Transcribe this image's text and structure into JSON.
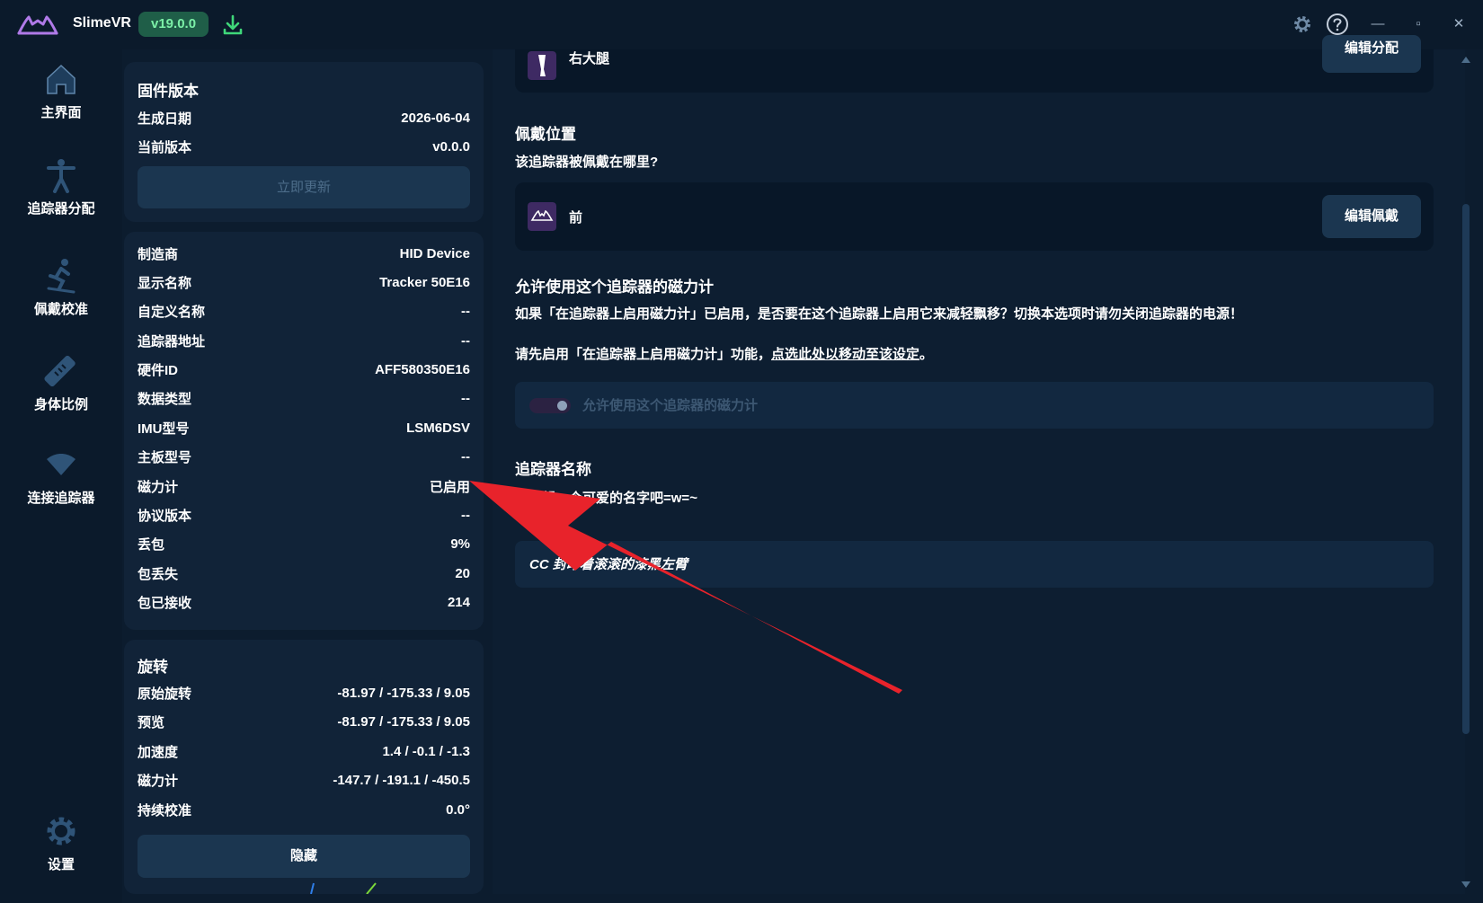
{
  "app": {
    "name": "SlimeVR",
    "version": "v19.0.0"
  },
  "sidebar": {
    "items": [
      {
        "label": "主界面",
        "icon": "home-icon"
      },
      {
        "label": "追踪器分配",
        "icon": "person-icon"
      },
      {
        "label": "佩戴校准",
        "icon": "skier-icon"
      },
      {
        "label": "身体比例",
        "icon": "ruler-icon"
      },
      {
        "label": "连接追踪器",
        "icon": "wifi-icon"
      },
      {
        "label": "设置",
        "icon": "gear-icon"
      }
    ]
  },
  "firmware": {
    "title": "固件版本",
    "rows": [
      {
        "k": "生成日期",
        "v": "2026-06-04"
      },
      {
        "k": "当前版本",
        "v": "v0.0.0"
      }
    ],
    "update_label": "立即更新"
  },
  "details": {
    "rows": [
      {
        "k": "制造商",
        "v": "HID Device"
      },
      {
        "k": "显示名称",
        "v": "Tracker 50E16"
      },
      {
        "k": "自定义名称",
        "v": "--"
      },
      {
        "k": "追踪器地址",
        "v": "--"
      },
      {
        "k": "硬件ID",
        "v": "AFF580350E16"
      },
      {
        "k": "数据类型",
        "v": "--"
      },
      {
        "k": "IMU型号",
        "v": "LSM6DSV"
      },
      {
        "k": "主板型号",
        "v": "--"
      },
      {
        "k": "磁力计",
        "v": "已启用"
      },
      {
        "k": "协议版本",
        "v": "--"
      },
      {
        "k": "丢包",
        "v": "9%"
      },
      {
        "k": "包丢失",
        "v": "20"
      },
      {
        "k": "包已接收",
        "v": "214"
      }
    ]
  },
  "rotation": {
    "title": "旋转",
    "rows": [
      {
        "k": "原始旋转",
        "v": "-81.97 / -175.33 / 9.05"
      },
      {
        "k": "预览",
        "v": "-81.97 / -175.33 / 9.05"
      },
      {
        "k": "加速度",
        "v": "1.4 / -0.1 / -1.3"
      },
      {
        "k": "磁力计",
        "v": "-147.7 / -191.1 / -450.5"
      },
      {
        "k": "持续校准",
        "v": "0.0°"
      }
    ],
    "hide_label": "隐藏"
  },
  "assignment": {
    "body_part": "右大腿",
    "edit_label": "编辑分配"
  },
  "mounting": {
    "title": "佩戴位置",
    "question": "该追踪器被佩戴在哪里?",
    "value": "前",
    "edit_label": "编辑佩戴"
  },
  "magnetometer": {
    "title": "允许使用这个追踪器的磁力计",
    "description": "如果「在追踪器上启用磁力计」已启用，是否要在这个追踪器上启用它来减轻飘移？切换本选项时请勿关闭追踪器的电源！",
    "hint_prefix": "请先启用「在追踪器上启用磁力计」功能，",
    "hint_link": "点选此处以移动至该设定",
    "hint_suffix": "。",
    "toggle_label": "允许使用这个追踪器的磁力计"
  },
  "tracker_name": {
    "title": "追踪器名称",
    "description": "给它起一个可爱的名字吧=w=~",
    "value": "CC 封印着滚滚的漆黑左臂"
  },
  "colors": {
    "accent": "#7cf0a8",
    "arrow": "#e8232b",
    "bg": "#0c1c2e"
  }
}
